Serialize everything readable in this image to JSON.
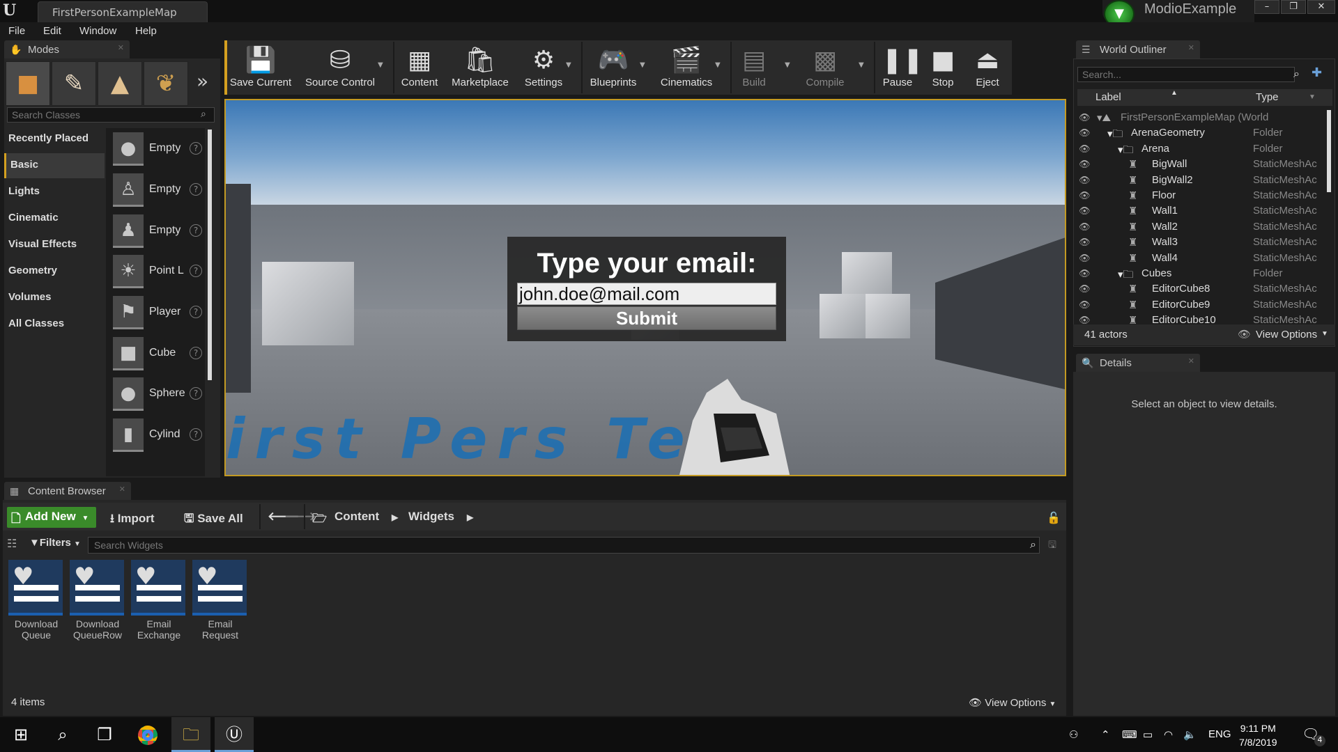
{
  "window": {
    "doc_tab": "FirstPersonExampleMap",
    "project_name": "ModioExample"
  },
  "menu": [
    "File",
    "Edit",
    "Window",
    "Help"
  ],
  "modes": {
    "tab_label": "Modes",
    "search_placeholder": "Search Classes",
    "categories": [
      "Recently Placed",
      "Basic",
      "Lights",
      "Cinematic",
      "Visual Effects",
      "Geometry",
      "Volumes",
      "All Classes"
    ],
    "selected_category": "Basic",
    "classes": [
      {
        "label": "Empty",
        "icon": "sphere-icon"
      },
      {
        "label": "Empty",
        "icon": "character-icon"
      },
      {
        "label": "Empty",
        "icon": "pawn-icon"
      },
      {
        "label": "Point L",
        "icon": "lightbulb-icon"
      },
      {
        "label": "Player",
        "icon": "player-start-icon"
      },
      {
        "label": "Cube",
        "icon": "cube-icon"
      },
      {
        "label": "Sphere",
        "icon": "sphere-icon"
      },
      {
        "label": "Cylind",
        "icon": "cylinder-icon"
      }
    ]
  },
  "toolbar": {
    "buttons": [
      {
        "label": "Save Current",
        "icon": "save-icon"
      },
      {
        "label": "Source Control",
        "icon": "source-control-icon"
      },
      {
        "label": "Content",
        "icon": "content-grid-icon"
      },
      {
        "label": "Marketplace",
        "icon": "marketplace-icon"
      },
      {
        "label": "Settings",
        "icon": "settings-icon"
      },
      {
        "label": "Blueprints",
        "icon": "blueprints-icon"
      },
      {
        "label": "Cinematics",
        "icon": "clapperboard-icon"
      },
      {
        "label": "Build",
        "icon": "build-icon"
      },
      {
        "label": "Compile",
        "icon": "compile-icon"
      },
      {
        "label": "Pause",
        "icon": "pause-icon"
      },
      {
        "label": "Stop",
        "icon": "stop-icon"
      },
      {
        "label": "Eject",
        "icon": "eject-icon"
      }
    ]
  },
  "viewport": {
    "widget_title": "Type your email:",
    "email_value": "john.doe@mail.com",
    "submit_label": "Submit",
    "floor_text": "irst Pers   Tem"
  },
  "outliner": {
    "tab_label": "World Outliner",
    "search_placeholder": "Search...",
    "col_label": "Label",
    "col_type": "Type",
    "rows": [
      {
        "label": "FirstPersonExampleMap (World",
        "type": "",
        "indent": 0
      },
      {
        "label": "ArenaGeometry",
        "type": "Folder",
        "indent": 1
      },
      {
        "label": "Arena",
        "type": "Folder",
        "indent": 2
      },
      {
        "label": "BigWall",
        "type": "StaticMeshAc",
        "indent": 3
      },
      {
        "label": "BigWall2",
        "type": "StaticMeshAc",
        "indent": 3
      },
      {
        "label": "Floor",
        "type": "StaticMeshAc",
        "indent": 3
      },
      {
        "label": "Wall1",
        "type": "StaticMeshAc",
        "indent": 3
      },
      {
        "label": "Wall2",
        "type": "StaticMeshAc",
        "indent": 3
      },
      {
        "label": "Wall3",
        "type": "StaticMeshAc",
        "indent": 3
      },
      {
        "label": "Wall4",
        "type": "StaticMeshAc",
        "indent": 3
      },
      {
        "label": "Cubes",
        "type": "Folder",
        "indent": 2
      },
      {
        "label": "EditorCube8",
        "type": "StaticMeshAc",
        "indent": 3
      },
      {
        "label": "EditorCube9",
        "type": "StaticMeshAc",
        "indent": 3
      },
      {
        "label": "EditorCube10",
        "type": "StaticMeshAc",
        "indent": 3
      }
    ],
    "actor_count": "41 actors",
    "view_options": "View Options"
  },
  "details": {
    "tab_label": "Details",
    "message": "Select an object to view details."
  },
  "content_browser": {
    "tab_label": "Content Browser",
    "add_new": "Add New",
    "import": "Import",
    "save_all": "Save All",
    "path": [
      "Content",
      "Widgets"
    ],
    "filters": "Filters",
    "search_placeholder": "Search Widgets",
    "assets": [
      "Download\nQueue",
      "Download\nQueueRow",
      "Email\nExchange",
      "Email\nRequest"
    ],
    "item_count": "4 items",
    "view_options": "View Options"
  },
  "taskbar": {
    "language": "ENG",
    "time": "9:11 PM",
    "date": "7/8/2019",
    "notifications": "4"
  }
}
